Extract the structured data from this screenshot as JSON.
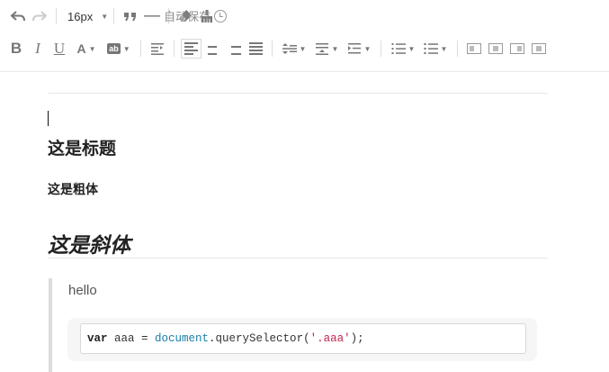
{
  "toolbar": {
    "font_size": "16px",
    "autosave_label": "自动保存",
    "format_letters": {
      "bold": "B",
      "italic": "I",
      "underline": "U",
      "font_color": "A",
      "bg_color": "ab"
    }
  },
  "editor": {
    "heading": "这是标题",
    "bold_text": "这是粗体",
    "italic_heading": "这是斜体",
    "quote_text": "hello",
    "code": {
      "keyword": "var",
      "before_obj": " aaa = ",
      "object": "document",
      "method": ".querySelector(",
      "string": "'.aaa'",
      "after": ");"
    }
  },
  "colors": {
    "toolbar_icon": "#6b6b6b",
    "code_string": "#c4224c",
    "code_object": "#1a7fa8"
  }
}
